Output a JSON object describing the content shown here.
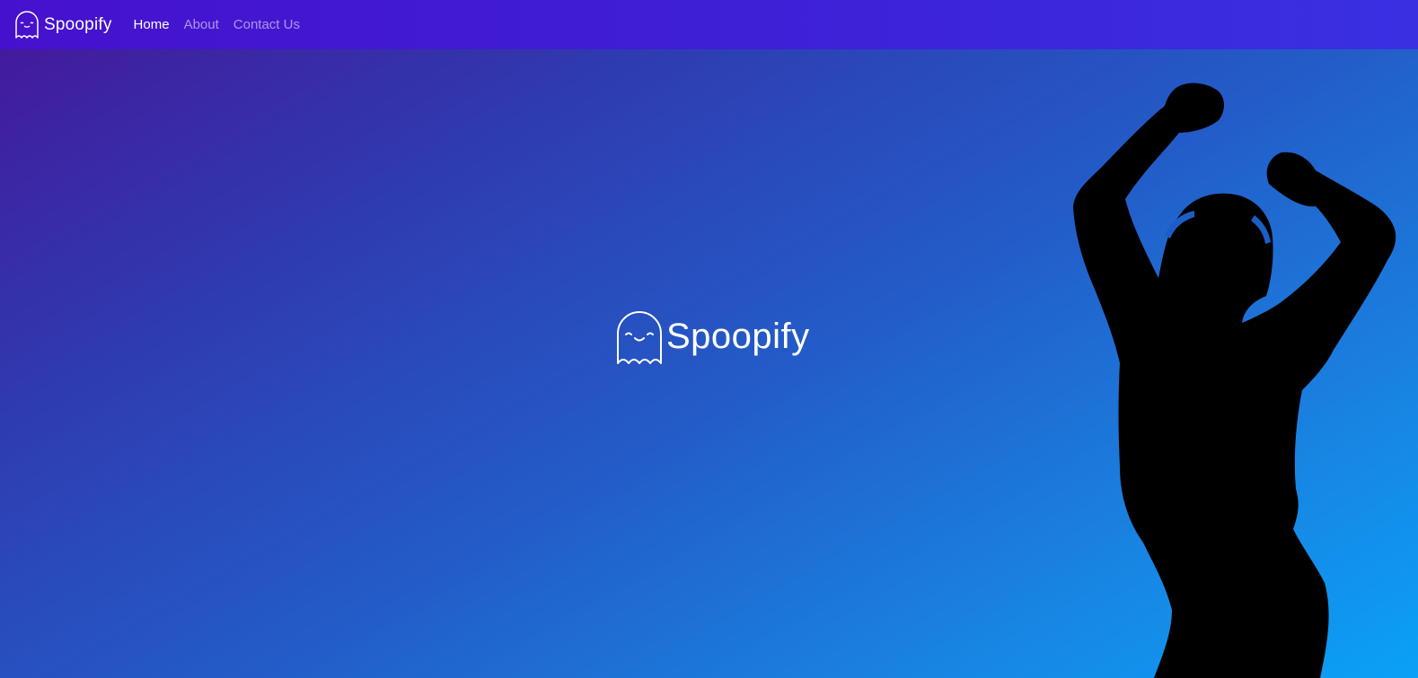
{
  "navbar": {
    "brand_name": "Spoopify",
    "brand_icon": "ghost-icon",
    "links": [
      {
        "label": "Home",
        "active": true
      },
      {
        "label": "About",
        "active": false
      },
      {
        "label": "Contact Us",
        "active": false
      }
    ]
  },
  "hero": {
    "logo_text": "Spoopify",
    "logo_icon": "ghost-icon",
    "image": "dancing-person-with-headphones-silhouette"
  },
  "colors": {
    "navbar": "#4312CF",
    "gradient_start": "#45169A",
    "gradient_end": "#0AA1F7",
    "text": "#FFFFFF",
    "silhouette": "#000000"
  }
}
